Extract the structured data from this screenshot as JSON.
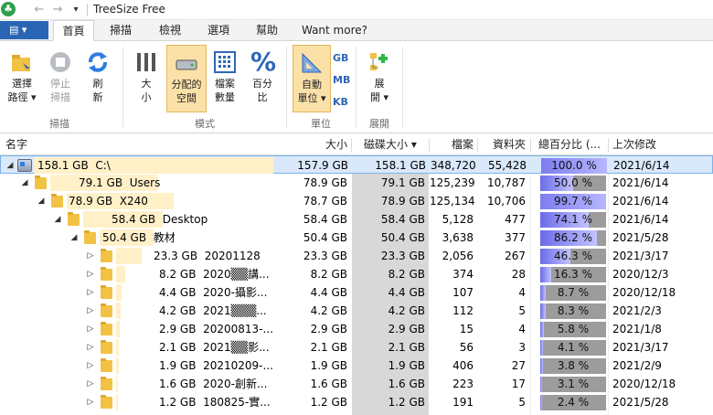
{
  "window": {
    "title": "TreeSize Free",
    "back_icon": "back-arrow-icon",
    "forward_icon": "forward-arrow-icon",
    "dropdown_glyph": "▾"
  },
  "menu": {
    "file_glyph": "▤ ▾"
  },
  "tabs": [
    {
      "label": "首頁",
      "active": true
    },
    {
      "label": "掃描"
    },
    {
      "label": "檢視"
    },
    {
      "label": "選項"
    },
    {
      "label": "幫助"
    },
    {
      "label": "Want more?"
    }
  ],
  "ribbon": {
    "scan_group": {
      "label": "掃描",
      "select_path": {
        "line1": "選擇",
        "line2": "路徑 ▾"
      },
      "stop_scan": {
        "line1": "停止",
        "line2": "掃描"
      },
      "refresh": {
        "line1": "刷",
        "line2": "新"
      }
    },
    "mode_group": {
      "label": "模式",
      "size": {
        "line1": "大",
        "line2": "小"
      },
      "allocated": {
        "line1": "分配的",
        "line2": "空間"
      },
      "file_count": {
        "line1": "檔案",
        "line2": "數量"
      },
      "percent": {
        "line1": "百分",
        "line2": "比"
      }
    },
    "unit_group": {
      "label": "單位",
      "auto": {
        "line1": "自動",
        "line2": "單位 ▾"
      },
      "gb": "GB",
      "mb": "MB",
      "kb": "KB"
    },
    "expand_group": {
      "label": "展開",
      "expand": {
        "line1": "展",
        "line2": "開 ▾"
      }
    }
  },
  "columns": {
    "name": "名字",
    "size": "大小",
    "disk_size": "磁碟大小 ▾",
    "files": "檔案",
    "folders": "資料夾",
    "percent": "總百分比 (...",
    "modified": "上次修改"
  },
  "rows": [
    {
      "expand": "◢",
      "size_label": "158.1 GB",
      "name": "C:\\",
      "size": "157.9 GB",
      "disk": "158.1 GB",
      "files": "348,720",
      "folders": "55,428",
      "pct_text": "100.0 %",
      "pct": 100,
      "date": "2021/6/14"
    },
    {
      "expand": "◢",
      "size_label": "79.1 GB",
      "name": "Users",
      "size": "78.9 GB",
      "disk": "79.1 GB",
      "files": "125,239",
      "folders": "10,787",
      "pct_text": "50.0 %",
      "pct": 50.0,
      "date": "2021/6/14"
    },
    {
      "expand": "◢",
      "size_label": "78.9 GB",
      "name": "X240",
      "size": "78.7 GB",
      "disk": "78.9 GB",
      "files": "125,134",
      "folders": "10,706",
      "pct_text": "99.7 %",
      "pct": 99.7,
      "date": "2021/6/14"
    },
    {
      "expand": "◢",
      "size_label": "58.4 GB",
      "name": "Desktop",
      "size": "58.4 GB",
      "disk": "58.4 GB",
      "files": "5,128",
      "folders": "477",
      "pct_text": "74.1 %",
      "pct": 74.1,
      "date": "2021/6/14"
    },
    {
      "expand": "◢",
      "size_label": "50.4 GB",
      "name": "教材",
      "size": "50.4 GB",
      "disk": "50.4 GB",
      "files": "3,638",
      "folders": "377",
      "pct_text": "86.2 %",
      "pct": 86.2,
      "date": "2021/5/28"
    },
    {
      "expand": "▷",
      "size_label": "23.3 GB",
      "name": "20201128",
      "size": "23.3 GB",
      "disk": "23.3 GB",
      "files": "2,056",
      "folders": "267",
      "pct_text": "46.3 %",
      "pct": 46.3,
      "date": "2021/3/17"
    },
    {
      "expand": "▷",
      "size_label": "8.2 GB",
      "name": "2020▒▒講...",
      "size": "8.2 GB",
      "disk": "8.2 GB",
      "files": "374",
      "folders": "28",
      "pct_text": "16.3 %",
      "pct": 16.3,
      "date": "2020/12/3"
    },
    {
      "expand": "▷",
      "size_label": "4.4 GB",
      "name": "2020-攝影...",
      "size": "4.4 GB",
      "disk": "4.4 GB",
      "files": "107",
      "folders": "4",
      "pct_text": "8.7 %",
      "pct": 8.7,
      "date": "2020/12/18"
    },
    {
      "expand": "▷",
      "size_label": "4.2 GB",
      "name": "2021▒▒▒...",
      "size": "4.2 GB",
      "disk": "4.2 GB",
      "files": "112",
      "folders": "5",
      "pct_text": "8.3 %",
      "pct": 8.3,
      "date": "2021/2/3"
    },
    {
      "expand": "▷",
      "size_label": "2.9 GB",
      "name": "20200813-...",
      "size": "2.9 GB",
      "disk": "2.9 GB",
      "files": "15",
      "folders": "4",
      "pct_text": "5.8 %",
      "pct": 5.8,
      "date": "2021/1/8"
    },
    {
      "expand": "▷",
      "size_label": "2.1 GB",
      "name": "2021▒▒影...",
      "size": "2.1 GB",
      "disk": "2.1 GB",
      "files": "56",
      "folders": "3",
      "pct_text": "4.1 %",
      "pct": 4.1,
      "date": "2021/3/17"
    },
    {
      "expand": "▷",
      "size_label": "1.9 GB",
      "name": "20210209-...",
      "size": "1.9 GB",
      "disk": "1.9 GB",
      "files": "406",
      "folders": "27",
      "pct_text": "3.8 %",
      "pct": 3.8,
      "date": "2021/2/9"
    },
    {
      "expand": "▷",
      "size_label": "1.6 GB",
      "name": "2020-創新...",
      "size": "1.6 GB",
      "disk": "1.6 GB",
      "files": "223",
      "folders": "17",
      "pct_text": "3.1 %",
      "pct": 3.1,
      "date": "2020/12/18"
    },
    {
      "expand": "▷",
      "size_label": "1.2 GB",
      "name": "180825-實...",
      "size": "1.2 GB",
      "disk": "1.2 GB",
      "files": "191",
      "folders": "5",
      "pct_text": "2.4 %",
      "pct": 2.4,
      "date": "2021/5/28"
    }
  ]
}
